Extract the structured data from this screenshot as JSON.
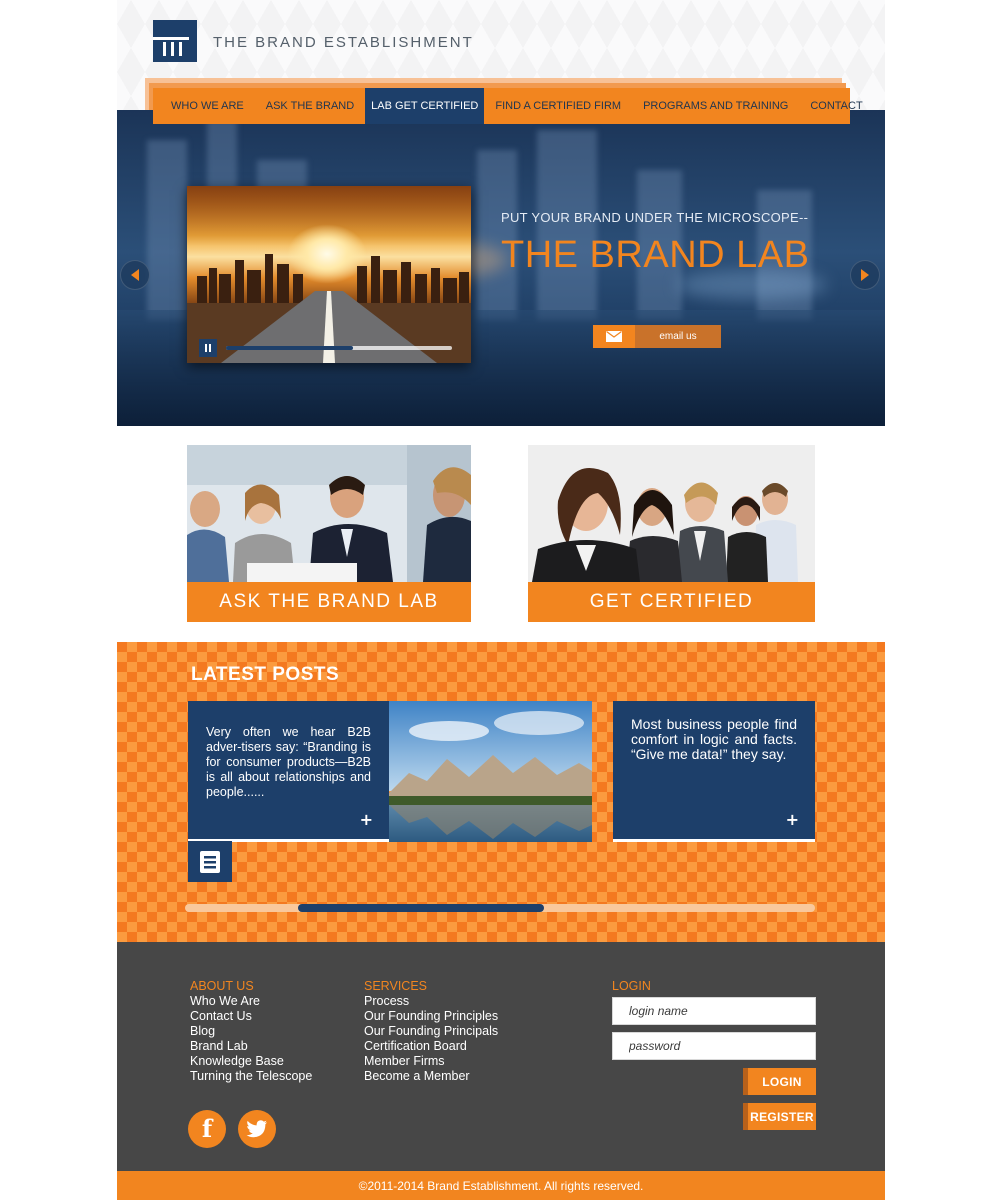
{
  "header": {
    "brand_name": "THE BRAND ESTABLISHMENT"
  },
  "nav": {
    "items": [
      {
        "label": "WHO WE ARE",
        "active": false
      },
      {
        "label": "ASK THE BRAND",
        "active": false
      },
      {
        "label": "LAB GET CERTIFIED",
        "active": true
      },
      {
        "label": "FIND A CERTIFIED FIRM",
        "active": false
      },
      {
        "label": "PROGRAMS AND TRAINING",
        "active": false
      },
      {
        "label": "CONTACT",
        "active": false
      }
    ]
  },
  "hero": {
    "tagline": "PUT YOUR BRAND UNDER THE MICROSCOPE--",
    "title": "THE BRAND LAB",
    "email_button": "email us",
    "video_progress": 0.56,
    "icons": {
      "left_arrow": "chevron-left-icon",
      "right_arrow": "chevron-right-icon",
      "pause": "pause-icon",
      "email": "envelope-icon"
    }
  },
  "features": {
    "ask_label": "ASK THE BRAND LAB",
    "certified_label": "GET CERTIFIED"
  },
  "posts": {
    "title": "LATEST POSTS",
    "items": [
      {
        "text": "Very often we hear B2B adver-tisers say: “Branding is for consumer products—B2B is all about relationships and people......",
        "more": "+"
      },
      {
        "text": "Most business people find comfort in logic and facts. “Give me data!” they say.",
        "more": "+"
      }
    ],
    "scroll_position": 0.18,
    "scroll_size": 0.39
  },
  "footer": {
    "about": {
      "heading": "ABOUT US",
      "links": [
        "Who We Are",
        "Contact Us",
        "Blog",
        "Brand Lab",
        "Knowledge Base",
        "Turning the Telescope"
      ]
    },
    "services": {
      "heading": "SERVICES",
      "links": [
        "Process",
        "Our Founding Principles",
        "Our Founding Principals",
        "Certification Board",
        "Member Firms",
        "Become a Member"
      ]
    },
    "login": {
      "heading": "LOGIN",
      "name_placeholder": "login name",
      "password_placeholder": "password",
      "login_button": "LOGIN",
      "register_button": "REGISTER"
    },
    "social": {
      "facebook_glyph": "f",
      "facebook_icon": "facebook-icon",
      "twitter_icon": "twitter-icon"
    },
    "copyright": "©2011-2014 Brand Establishment. All rights reserved."
  },
  "colors": {
    "accent": "#f2851f",
    "navy": "#1d3f6a",
    "footer_bg": "#474747"
  }
}
